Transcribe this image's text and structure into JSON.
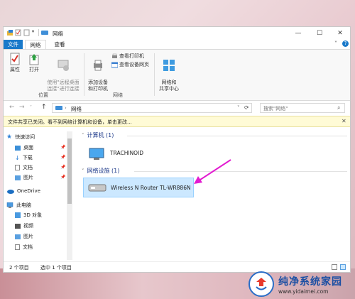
{
  "window": {
    "title": "网络",
    "controls": {
      "minimize": "—",
      "maximize": "☐",
      "close": "✕"
    },
    "help": "?",
    "ribbon_toggle": "˅"
  },
  "tabs": [
    {
      "label": "文件"
    },
    {
      "label": "网络"
    },
    {
      "label": "查看"
    }
  ],
  "ribbon": {
    "location_group": {
      "label": "位置",
      "properties": "属性",
      "open": "打开",
      "remote_desktop": "使用\"远程桌面\n连接\"进行连接"
    },
    "network_group": {
      "label": "网络",
      "add_devices": "添加设备\n和打印机",
      "view_printers": "查看打印机",
      "view_device_web": "查看设备网页"
    },
    "center": {
      "label": "网络和\n共享中心"
    }
  },
  "address": {
    "path": "网络",
    "search_placeholder": "搜索\"网络\""
  },
  "infobar": {
    "text": "文件共享已关闭。看不到网络计算机和设备，单击更改..."
  },
  "navpane": {
    "quick_access": "快速访问",
    "items": [
      {
        "label": "桌面"
      },
      {
        "label": "下载"
      },
      {
        "label": "文档"
      },
      {
        "label": "图片"
      }
    ],
    "onedrive": "OneDrive",
    "this_pc": "此电脑",
    "pc_items": [
      {
        "label": "3D 对象"
      },
      {
        "label": "视频"
      },
      {
        "label": "图片"
      },
      {
        "label": "文档"
      }
    ]
  },
  "content": {
    "computers_group": "计算机 (1)",
    "computer_name": "TRACHINOID",
    "infra_group": "网络设施 (1)",
    "router_name": "Wireless N Router TL-WR886N"
  },
  "status": {
    "items_count": "2 个项目",
    "selected": "选中 1 个项目"
  },
  "watermark": {
    "title": "纯净系统家园",
    "url": "www.yidaimei.com"
  },
  "colors": {
    "accent": "#1979ca",
    "selection": "#cce8ff",
    "infobar": "#fffbd6",
    "arrow": "#e21bd0"
  }
}
